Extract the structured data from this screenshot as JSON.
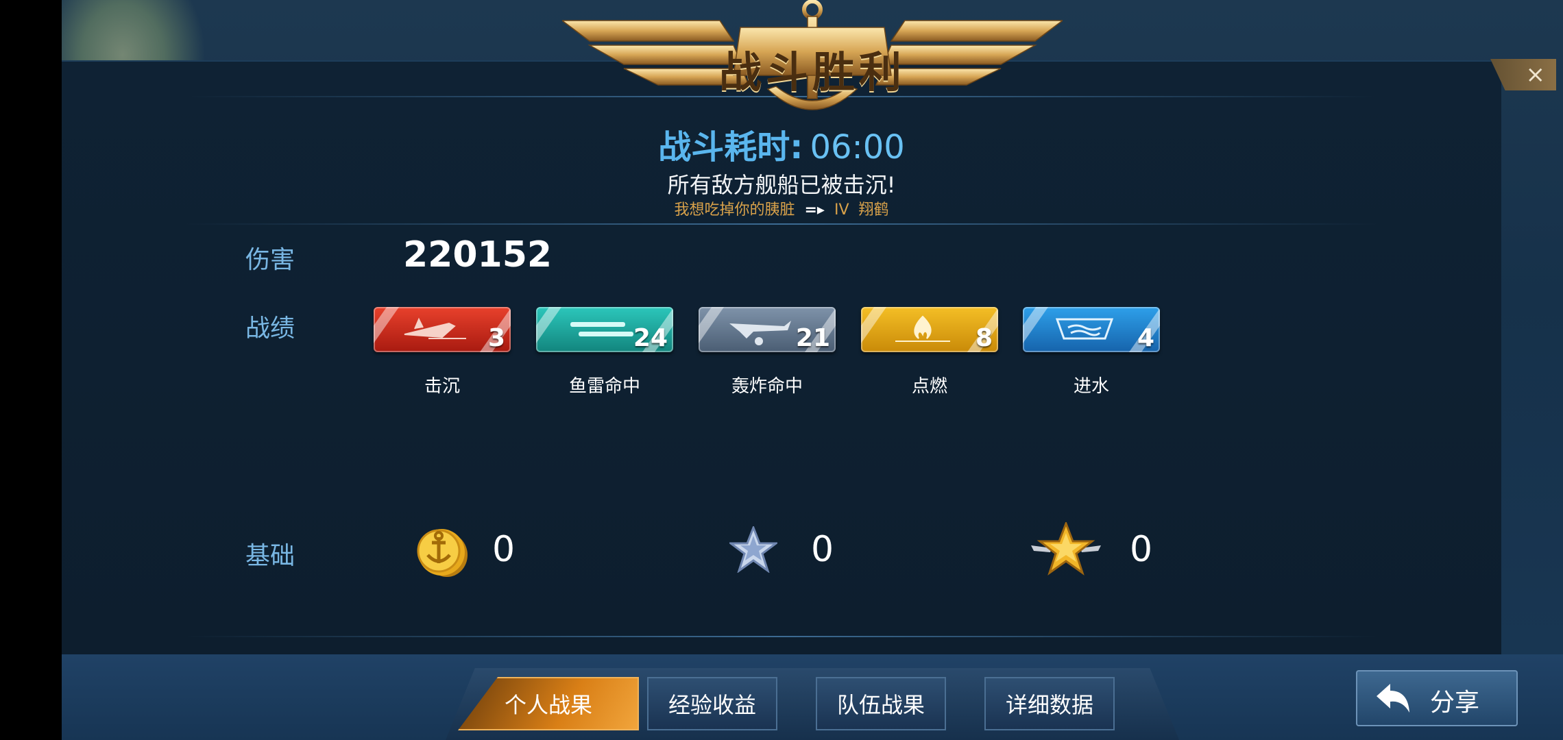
{
  "header": {
    "title": "战斗胜利",
    "close_icon": "×",
    "duration_label": "战斗耗时:",
    "duration_value": "06:00",
    "result_text": "所有敌方舰船已被击沉!",
    "killer": "我想吃掉你的胰脏",
    "kill_arrow": "=▸",
    "victim_tier": "IV",
    "victim_ship": "翔鹤"
  },
  "stats": {
    "damage_label": "伤害",
    "damage_value": "220152",
    "record_label": "战绩",
    "base_label": "基础"
  },
  "achievements": [
    {
      "name": "击沉",
      "value": "3",
      "color": "#c8281a",
      "icon": "ship-sink-icon"
    },
    {
      "name": "鱼雷命中",
      "value": "24",
      "color": "#1aa39a",
      "icon": "torpedo-icon"
    },
    {
      "name": "轰炸命中",
      "value": "21",
      "color": "#5b6f86",
      "icon": "bomber-icon"
    },
    {
      "name": "点燃",
      "value": "8",
      "color": "#d99a10",
      "icon": "fire-icon"
    },
    {
      "name": "进水",
      "value": "4",
      "color": "#1d86d4",
      "icon": "flood-icon"
    }
  ],
  "base_rewards": [
    {
      "icon": "gold-coin-icon",
      "value": "0"
    },
    {
      "icon": "silver-star-icon",
      "value": "0"
    },
    {
      "icon": "gold-star-icon",
      "value": "0"
    }
  ],
  "tabs": [
    {
      "label": "个人战果",
      "active": true
    },
    {
      "label": "经验收益",
      "active": false
    },
    {
      "label": "队伍战果",
      "active": false
    },
    {
      "label": "详细数据",
      "active": false
    }
  ],
  "share": {
    "label": "分享",
    "icon": "return-arrow-icon"
  }
}
